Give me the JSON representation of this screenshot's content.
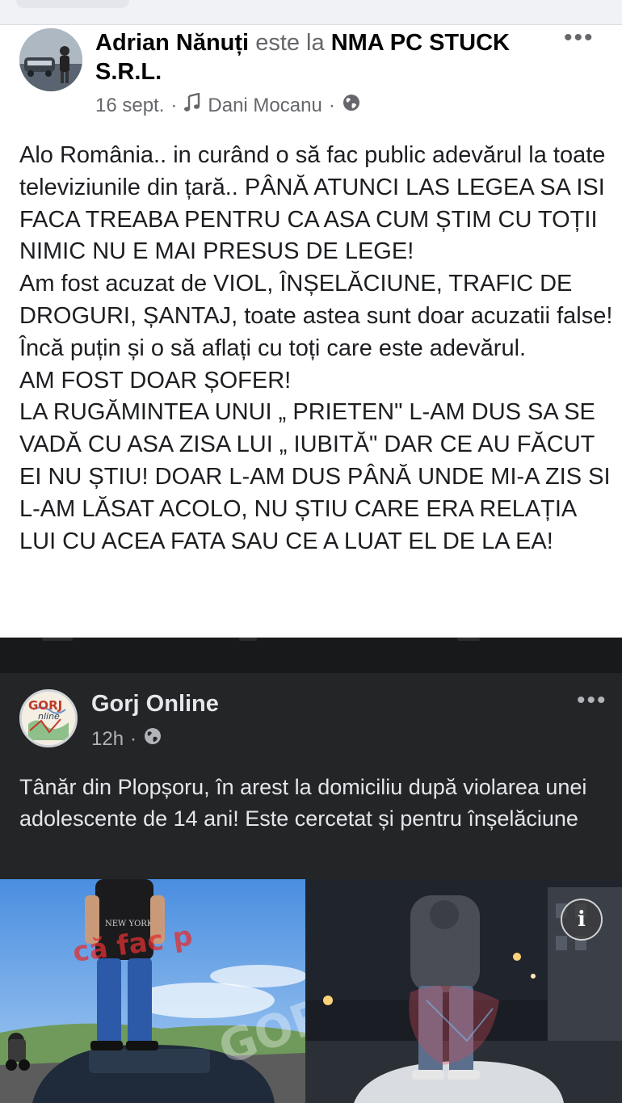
{
  "post1": {
    "author": "Adrian Nănuți",
    "is_at": "este la",
    "location": "NMA PC STUCK S.R.L.",
    "date": "16 sept.",
    "sep": "·",
    "music_artist": "Dani Mocanu",
    "more_label": "•••",
    "paragraphs": [
      "Alo România.. in curând o să fac public adevărul la toate televiziunile din țară.. PÂNĂ ATUNCI LAS LEGEA SA ISI FACA TREABA PENTRU CA ASA CUM ȘTIM CU TOȚII NIMIC NU E MAI PRESUS DE LEGE!",
      "Am fost acuzat de VIOL, ÎNȘELĂCIUNE, TRAFIC DE DROGURI, ȘANTAJ, toate astea sunt doar acuzatii false!",
      "Încă puțin și o să aflați cu toți care este adevărul.",
      "AM FOST DOAR ȘOFER!",
      "LA RUGĂMINTEA UNUI „ PRIETEN\" L-AM DUS SA SE VADĂ CU ASA ZISA LUI „ IUBITĂ\" DAR CE AU FĂCUT EI NU ȘTIU! DOAR L-AM DUS PÂNĂ UNDE MI-A ZIS SI L-AM LĂSAT ACOLO, NU ȘTIU CARE ERA RELAȚIA LUI CU ACEA FATA SAU CE A LUAT EL DE LA EA!"
    ]
  },
  "post2": {
    "page_name": "Gorj Online",
    "time": "12h",
    "sep": "·",
    "more_label": "•••",
    "text": "Tânăr din Plopșoru, în arest la domiciliu după violarea unei adolescente de 14 ani! Este cercetat și pentru înșelăciune",
    "logo_text": "GORJ Online",
    "watermark_left": "că fac p",
    "info_label": "i"
  },
  "icons": {
    "music": "music-note-icon",
    "privacy": "globe-icon",
    "more": "more-options-icon",
    "info": "info-icon"
  },
  "colors": {
    "light_bg": "#ffffff",
    "dark_bg": "#242526",
    "muted_text": "#65676b",
    "dark_text": "#e4e6eb"
  }
}
